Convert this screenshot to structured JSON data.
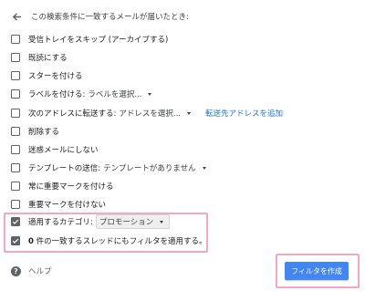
{
  "header": {
    "text": "この検索条件に一致するメールが届いたとき:"
  },
  "options": [
    {
      "label": "受信トレイをスキップ (アーカイブする)",
      "checked": false
    },
    {
      "label": "既読にする",
      "checked": false
    },
    {
      "label": "スターを付ける",
      "checked": false
    },
    {
      "label": "ラベルを付ける:",
      "select": "ラベルを選択...",
      "checked": false
    },
    {
      "label": "次のアドレスに転送する:",
      "select": "アドレスを選択...",
      "link": "転送先アドレスを追加",
      "checked": false
    },
    {
      "label": "削除する",
      "checked": false
    },
    {
      "label": "迷惑メールにしない",
      "checked": false
    },
    {
      "label": "テンプレートの送信:",
      "select": "テンプレートがありません",
      "checked": false
    },
    {
      "label": "常に重要マークを付ける",
      "checked": false
    },
    {
      "label": "重要マークを付けない",
      "checked": false
    },
    {
      "label": "適用するカテゴリ:",
      "select": "プロモーション",
      "checked": true
    },
    {
      "label_bold": "0",
      "label": " 件の一致するスレッドにもフィルタを適用する。",
      "checked": true
    }
  ],
  "help": {
    "label": "ヘルプ"
  },
  "create_button": {
    "label": "フィルタを作成"
  },
  "colors": {
    "accent": "#4285f4",
    "link": "#1a73e8",
    "highlight": "#f2a8c4",
    "checkbox": "#5f6368"
  }
}
